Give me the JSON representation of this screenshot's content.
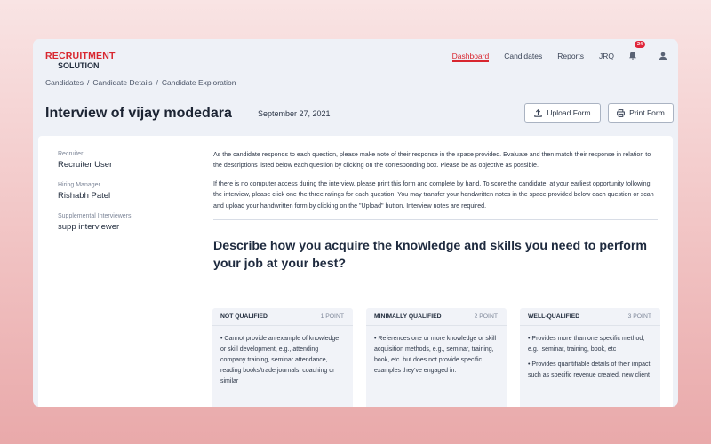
{
  "app": {
    "logo_line1": "RECRUITMENT",
    "logo_line2": "SOLUTION",
    "accent_color": "#d8262f"
  },
  "nav": {
    "items": [
      {
        "label": "Dashboard",
        "active": true
      },
      {
        "label": "Candidates",
        "active": false
      },
      {
        "label": "Reports",
        "active": false
      },
      {
        "label": "JRQ",
        "active": false
      }
    ],
    "notification_count": "24",
    "bell_icon": "bell-icon",
    "user_icon": "user-icon"
  },
  "breadcrumb": [
    "Candidates",
    "Candidate Details",
    "Candidate Exploration"
  ],
  "header": {
    "title": "Interview of vijay modedara",
    "date": "September 27, 2021",
    "upload_label": "Upload Form",
    "print_label": "Print Form"
  },
  "sidebar": {
    "recruiter_label": "Recruiter",
    "recruiter_value": "Recruiter User",
    "hiring_manager_label": "Hiring Manager",
    "hiring_manager_value": "Rishabh Patel",
    "supplemental_label": "Supplemental Interviewers",
    "supplemental_value": "supp interviewer"
  },
  "instructions": {
    "p1": "As the candidate responds to each question, please make note of their response in the space provided. Evaluate and then match their response in relation to the descriptions listed below each question by clicking on the corresponding box. Please be as objective as possible.",
    "p2": "If there is no computer access during the interview, please print this form and complete by hand. To score the candidate, at your earliest opportunity following the interview, please click one the three ratings for each question. You may transfer your handwritten notes in the space provided below each question or scan and upload your handwritten form by clicking on the \"Upload\" button. Interview notes are required."
  },
  "question": {
    "text": "Describe how you acquire the knowledge and skills you need to perform your job at your best?"
  },
  "ratings": [
    {
      "name": "NOT QUALIFIED",
      "points": "1 POINT",
      "bullets": [
        "• Cannot provide an example of knowledge or skill development, e.g., attending company training, seminar attendance, reading books/trade journals, coaching or similar"
      ]
    },
    {
      "name": "MINIMALLY QUALIFIED",
      "points": "2 POINT",
      "bullets": [
        "• References one or more knowledge or skill acquisition methods, e.g., seminar, training, book, etc. but does not provide specific examples they've engaged in."
      ]
    },
    {
      "name": "WELL-QUALIFIED",
      "points": "3 POINT",
      "bullets": [
        "• Provides more than one specific method, e.g., seminar, training, book, etc",
        "• Provides quantifiable details of their impact such as specific revenue created, new client"
      ]
    }
  ]
}
